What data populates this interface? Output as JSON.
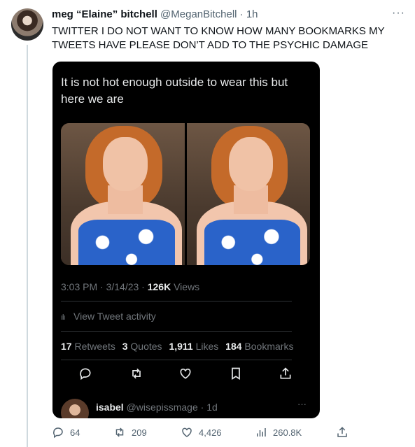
{
  "tweet": {
    "author_name": "meg “Elaine” bitchell",
    "handle": "@MeganBitchell",
    "separator": "·",
    "time": "1h",
    "text": "TWITTER I DO NOT WANT TO KNOW HOW MANY BOOKMARKS MY TWEETS HAVE PLEASE DON’T ADD TO THE PSYCHIC DAMAGE"
  },
  "embedded": {
    "text": "It is not hot enough outside to wear this but here we are",
    "time": "3:03 PM · 3/14/23 · ",
    "views_count": "126K",
    "views_label": " Views",
    "activity_label": "View Tweet activity",
    "retweets_count": "17",
    "retweets_label": "Retweets",
    "quotes_count": "3",
    "quotes_label": "Quotes",
    "likes_count": "1,911",
    "likes_label": "Likes",
    "bookmarks_count": "184",
    "bookmarks_label": "Bookmarks",
    "reply": {
      "name": "isabel",
      "handle": "@wisepissmage",
      "separator": "·",
      "time": "1d"
    }
  },
  "actions": {
    "replies": "64",
    "retweets": "209",
    "likes": "4,426",
    "views": "260.8K"
  },
  "colors": {
    "accent": "#1d9bf0",
    "muted": "#536471",
    "text": "#0f1419",
    "dark_card": "#000000"
  }
}
